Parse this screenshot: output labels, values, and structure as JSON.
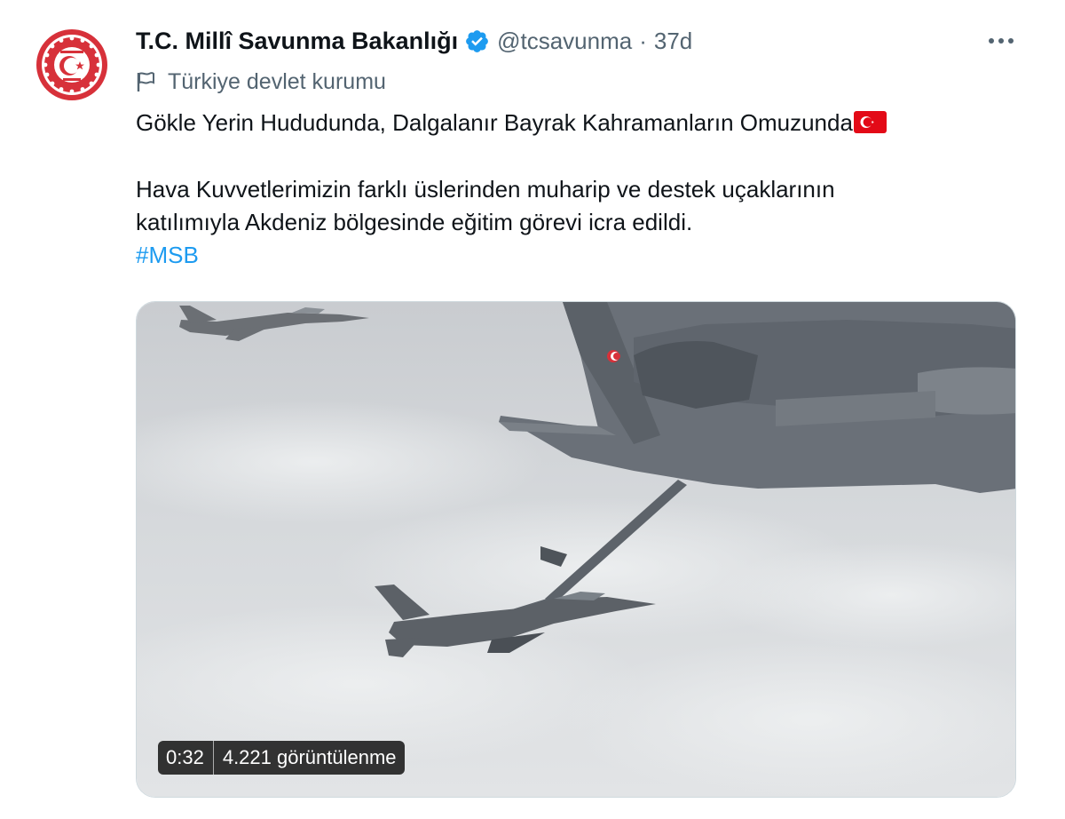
{
  "account": {
    "display_name": "T.C. Millî Savunma Bakanlığı",
    "handle": "@tcsavunma",
    "separator": "·",
    "timestamp": "37d",
    "verified": true,
    "avatar_icon": "msb-emblem-icon",
    "label": "Türkiye devlet kurumu",
    "label_icon": "flag-outline-icon"
  },
  "tweet": {
    "line1": "Gökle Yerin Hududunda, Dalgalanır Bayrak Kahramanların Omuzunda",
    "line1_emoji": "turkey-flag-emoji",
    "line2": "Hava Kuvvetlerimizin farklı üslerinden muharip ve destek uçaklarının",
    "line3": "katılımıyla Akdeniz bölgesinde eğitim görevi icra edildi.",
    "hashtag": "#MSB"
  },
  "media": {
    "type": "video",
    "duration": "0:32",
    "views": "4.221 görüntülenme"
  },
  "colors": {
    "text_primary": "#0f1419",
    "text_secondary": "#536471",
    "link": "#1d9bf0",
    "verified_badge": "#1d9bf0",
    "emblem_red": "#d7313a"
  },
  "icons": {
    "more": "more-horizontal-icon",
    "verified": "verified-badge-icon"
  }
}
